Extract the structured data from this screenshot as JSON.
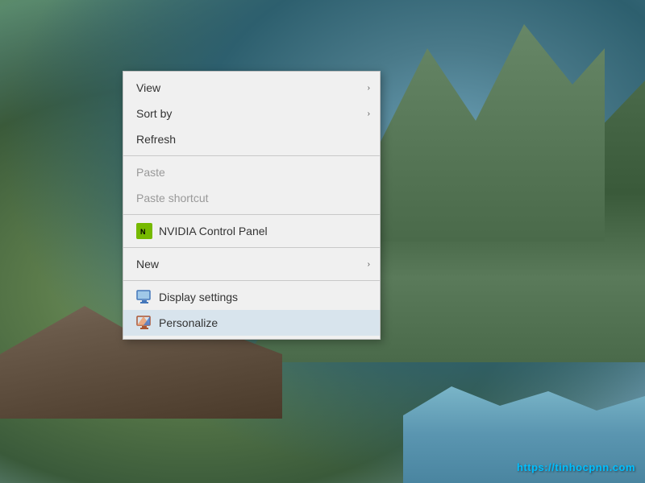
{
  "desktop": {
    "watermark": "https://tinhocpnn.com"
  },
  "context_menu": {
    "items": [
      {
        "id": "view",
        "label": "View",
        "has_submenu": true,
        "disabled": false,
        "has_icon": false,
        "highlighted": false
      },
      {
        "id": "sort-by",
        "label": "Sort by",
        "has_submenu": true,
        "disabled": false,
        "has_icon": false,
        "highlighted": false
      },
      {
        "id": "refresh",
        "label": "Refresh",
        "has_submenu": false,
        "disabled": false,
        "has_icon": false,
        "highlighted": false
      },
      {
        "id": "sep1",
        "type": "separator"
      },
      {
        "id": "paste",
        "label": "Paste",
        "has_submenu": false,
        "disabled": true,
        "has_icon": false,
        "highlighted": false
      },
      {
        "id": "paste-shortcut",
        "label": "Paste shortcut",
        "has_submenu": false,
        "disabled": true,
        "has_icon": false,
        "highlighted": false
      },
      {
        "id": "sep2",
        "type": "separator"
      },
      {
        "id": "nvidia",
        "label": "NVIDIA Control Panel",
        "has_submenu": false,
        "disabled": false,
        "has_icon": true,
        "icon_type": "nvidia",
        "highlighted": false
      },
      {
        "id": "sep3",
        "type": "separator"
      },
      {
        "id": "new",
        "label": "New",
        "has_submenu": true,
        "disabled": false,
        "has_icon": false,
        "highlighted": false
      },
      {
        "id": "sep4",
        "type": "separator"
      },
      {
        "id": "display-settings",
        "label": "Display settings",
        "has_submenu": false,
        "disabled": false,
        "has_icon": true,
        "icon_type": "display",
        "highlighted": false
      },
      {
        "id": "personalize",
        "label": "Personalize",
        "has_submenu": false,
        "disabled": false,
        "has_icon": true,
        "icon_type": "personalize",
        "highlighted": true
      }
    ],
    "chevron": "›"
  }
}
